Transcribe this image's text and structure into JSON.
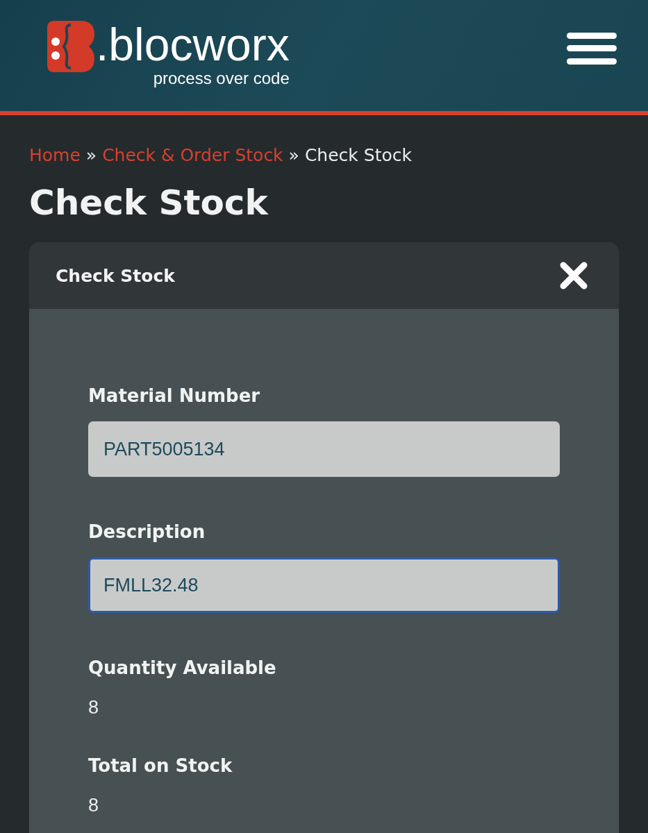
{
  "header": {
    "logo_text": ".blocworx",
    "tagline": "process over code"
  },
  "breadcrumb": [
    {
      "kind": "link",
      "label": "Home"
    },
    {
      "kind": "separator",
      "label": "»"
    },
    {
      "kind": "link",
      "label": "Check & Order Stock"
    },
    {
      "kind": "separator",
      "label": "»"
    },
    {
      "kind": "current",
      "label": "Check Stock"
    }
  ],
  "page_title": "Check Stock",
  "panel": {
    "title": "Check Stock",
    "fields": [
      {
        "kind": "input",
        "label": "Material Number",
        "value": "PART5005134",
        "focused": false
      },
      {
        "kind": "input",
        "label": "Description",
        "value": "FMLL32.48",
        "focused": true
      },
      {
        "kind": "readonly",
        "label": "Quantity Available",
        "value": "8"
      },
      {
        "kind": "readonly",
        "label": "Total on Stock",
        "value": "8"
      }
    ]
  }
}
